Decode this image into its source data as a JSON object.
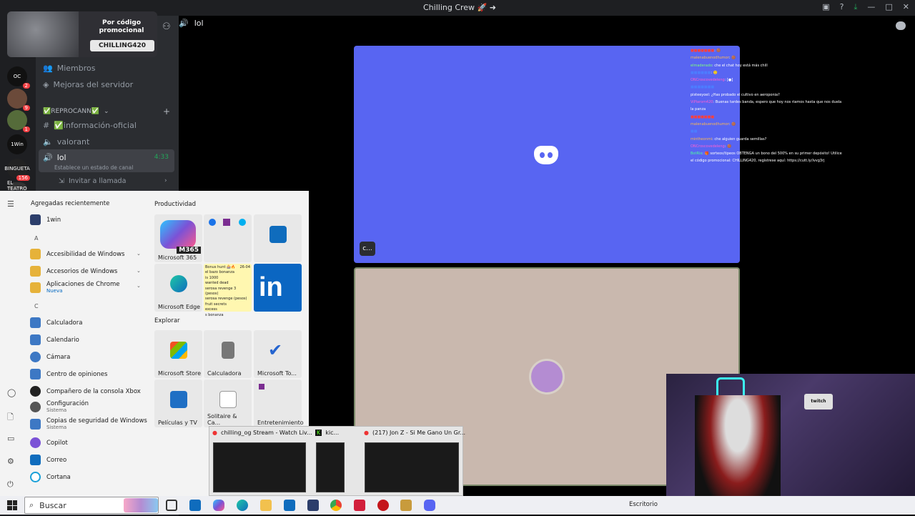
{
  "window": {
    "title": "Chilling Crew 🚀 ➜",
    "controls": [
      "—",
      "□",
      "✕"
    ]
  },
  "promo": {
    "line1": "Por código",
    "line2": "promocional",
    "code": "CHILLING420"
  },
  "servers": [
    {
      "label": "OC",
      "badge": "2"
    },
    {
      "label": "",
      "badge": "9"
    },
    {
      "label": "",
      "badge": "1"
    },
    {
      "label": "1Win",
      "badge": ""
    },
    {
      "label": "BINGUETA",
      "badge": "156"
    },
    {
      "label": "EL TEATRO",
      "badge": ""
    }
  ],
  "channels": {
    "members": "Miembros",
    "boosts": "Mejoras del servidor",
    "category": "✅REPROCANN✅",
    "info": "✅información-oficial",
    "valorant": "valorant",
    "voice": "lol",
    "voice_time": "4:33",
    "status_prompt": "Establece un estado de canal",
    "invite": "Invitar a llamada"
  },
  "voice_header": {
    "channel": "lol"
  },
  "tile1": {
    "tag": "c..."
  },
  "chat": [
    {
      "user": "■■■■■■■",
      "msg": ": 🟤"
    },
    {
      "user": "malenabuenodhumor",
      "msg": ": 🟤"
    },
    {
      "user": "elmaderado",
      "msg": ": che el chat hoy está más chill"
    },
    {
      "user": "■■■■■■",
      "msg": ": 🙂"
    },
    {
      "user": "ONCroscovedeleng",
      "msg": ": [●]"
    },
    {
      "user": "■■■■■■■",
      "msg": ""
    },
    {
      "user": "pisteeyoel",
      "msg": ": ¿Has probado el cultivo en aeroponia?"
    },
    {
      "user": "ViPiarom420",
      "msg": ": Buenas tardes banda, espero que hoy nos riamos hasta que nos duela la panza"
    },
    {
      "user": "■■■■■■■",
      "msg": ""
    },
    {
      "user": "malenabuenodhumor",
      "msg": ": 🟤"
    },
    {
      "user": "■■",
      "msg": ""
    },
    {
      "user": "mintheonmi",
      "msg": ": che alguien guarda semillas?"
    },
    {
      "user": "ONCroscovedeleng",
      "msg": ": 🟤"
    },
    {
      "user": "BotRix",
      "msg": ": 🎁 sorteos/tipeos OBTENGA un bono del 500% en su primer depósito! Utilice el código promocional: CHILLING420, regístrese aquí: https://cutt.ly/lvvg3rj"
    }
  ],
  "webcam": {
    "sign": "twitch"
  },
  "start_menu": {
    "recent_header": "Agregadas recientemente",
    "recent_app": "1win",
    "apps": [
      {
        "letter": "A"
      },
      {
        "name": "Accesibilidad de Windows",
        "sub": "",
        "color": "#e6b23a"
      },
      {
        "name": "Accesorios de Windows",
        "sub": "",
        "color": "#e6b23a"
      },
      {
        "name": "Aplicaciones de Chrome",
        "sub": "Nueva",
        "color": "#e6b23a"
      },
      {
        "letter": "C"
      },
      {
        "name": "Calculadora",
        "sub": "",
        "color": "#3d78c4"
      },
      {
        "name": "Calendario",
        "sub": "",
        "color": "#3d78c4"
      },
      {
        "name": "Cámara",
        "sub": "",
        "color": "#3d78c4"
      },
      {
        "name": "Centro de opiniones",
        "sub": "",
        "color": "#3d78c4"
      },
      {
        "name": "Compañero de la consola Xbox",
        "sub": "",
        "color": "#222"
      },
      {
        "name": "Configuración",
        "sub": "Sistema",
        "color": "#555"
      },
      {
        "name": "Copias de seguridad de Windows",
        "sub": "Sistema",
        "color": "#3d78c4"
      },
      {
        "name": "Copilot",
        "sub": "",
        "color": "#7b52d6"
      },
      {
        "name": "Correo",
        "sub": "",
        "color": "#0f6cbd"
      },
      {
        "name": "Cortana",
        "sub": "",
        "color": "#1aa0d8"
      }
    ],
    "sections": {
      "productivity": "Productividad",
      "explore": "Explorar"
    },
    "tiles": {
      "m365": "Microsoft 365",
      "m365_badge": "M365",
      "edge": "Microsoft Edge",
      "store": "Microsoft Store",
      "calc": "Calculadora",
      "todo": "Microsoft To...",
      "movies": "Películas y TV",
      "solitaire": "Solitaire & Ca...",
      "entertainment": "Entretenimiento"
    },
    "notes_title": "Bonus hunt 🎰🔥",
    "notes_date": "26-04",
    "notes_lines": [
      "el bazo bonanza",
      "is 1000",
      "wanted dead",
      "serosa revenge 3 (pesos)",
      "serosa revenge (pesos)",
      "fruit secrets",
      "excess",
      "s bonanza"
    ]
  },
  "previews": [
    {
      "title": "chilling_og Stream - Watch Liv..."
    },
    {
      "title": "kic..."
    },
    {
      "title": "(217) Jon Z - Si Me Gano Un Gr..."
    }
  ],
  "taskbar": {
    "search_placeholder": "Buscar",
    "desktop_label": "Escritorio"
  },
  "colors": {
    "discord_blurple": "#5865f2",
    "voice_active": "#23a55a"
  }
}
